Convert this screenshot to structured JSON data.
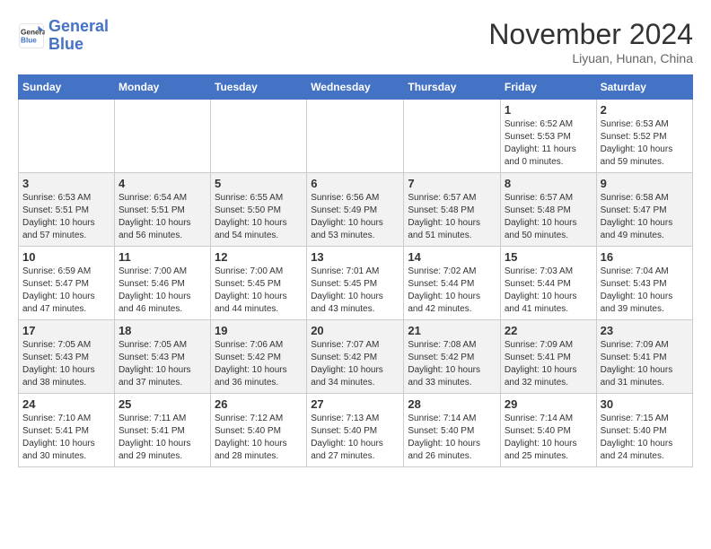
{
  "logo": {
    "line1": "General",
    "line2": "Blue"
  },
  "header": {
    "title": "November 2024",
    "subtitle": "Liyuan, Hunan, China"
  },
  "weekdays": [
    "Sunday",
    "Monday",
    "Tuesday",
    "Wednesday",
    "Thursday",
    "Friday",
    "Saturday"
  ],
  "weeks": [
    [
      {
        "day": "",
        "info": ""
      },
      {
        "day": "",
        "info": ""
      },
      {
        "day": "",
        "info": ""
      },
      {
        "day": "",
        "info": ""
      },
      {
        "day": "",
        "info": ""
      },
      {
        "day": "1",
        "info": "Sunrise: 6:52 AM\nSunset: 5:53 PM\nDaylight: 11 hours and 0 minutes."
      },
      {
        "day": "2",
        "info": "Sunrise: 6:53 AM\nSunset: 5:52 PM\nDaylight: 10 hours and 59 minutes."
      }
    ],
    [
      {
        "day": "3",
        "info": "Sunrise: 6:53 AM\nSunset: 5:51 PM\nDaylight: 10 hours and 57 minutes."
      },
      {
        "day": "4",
        "info": "Sunrise: 6:54 AM\nSunset: 5:51 PM\nDaylight: 10 hours and 56 minutes."
      },
      {
        "day": "5",
        "info": "Sunrise: 6:55 AM\nSunset: 5:50 PM\nDaylight: 10 hours and 54 minutes."
      },
      {
        "day": "6",
        "info": "Sunrise: 6:56 AM\nSunset: 5:49 PM\nDaylight: 10 hours and 53 minutes."
      },
      {
        "day": "7",
        "info": "Sunrise: 6:57 AM\nSunset: 5:48 PM\nDaylight: 10 hours and 51 minutes."
      },
      {
        "day": "8",
        "info": "Sunrise: 6:57 AM\nSunset: 5:48 PM\nDaylight: 10 hours and 50 minutes."
      },
      {
        "day": "9",
        "info": "Sunrise: 6:58 AM\nSunset: 5:47 PM\nDaylight: 10 hours and 49 minutes."
      }
    ],
    [
      {
        "day": "10",
        "info": "Sunrise: 6:59 AM\nSunset: 5:47 PM\nDaylight: 10 hours and 47 minutes."
      },
      {
        "day": "11",
        "info": "Sunrise: 7:00 AM\nSunset: 5:46 PM\nDaylight: 10 hours and 46 minutes."
      },
      {
        "day": "12",
        "info": "Sunrise: 7:00 AM\nSunset: 5:45 PM\nDaylight: 10 hours and 44 minutes."
      },
      {
        "day": "13",
        "info": "Sunrise: 7:01 AM\nSunset: 5:45 PM\nDaylight: 10 hours and 43 minutes."
      },
      {
        "day": "14",
        "info": "Sunrise: 7:02 AM\nSunset: 5:44 PM\nDaylight: 10 hours and 42 minutes."
      },
      {
        "day": "15",
        "info": "Sunrise: 7:03 AM\nSunset: 5:44 PM\nDaylight: 10 hours and 41 minutes."
      },
      {
        "day": "16",
        "info": "Sunrise: 7:04 AM\nSunset: 5:43 PM\nDaylight: 10 hours and 39 minutes."
      }
    ],
    [
      {
        "day": "17",
        "info": "Sunrise: 7:05 AM\nSunset: 5:43 PM\nDaylight: 10 hours and 38 minutes."
      },
      {
        "day": "18",
        "info": "Sunrise: 7:05 AM\nSunset: 5:43 PM\nDaylight: 10 hours and 37 minutes."
      },
      {
        "day": "19",
        "info": "Sunrise: 7:06 AM\nSunset: 5:42 PM\nDaylight: 10 hours and 36 minutes."
      },
      {
        "day": "20",
        "info": "Sunrise: 7:07 AM\nSunset: 5:42 PM\nDaylight: 10 hours and 34 minutes."
      },
      {
        "day": "21",
        "info": "Sunrise: 7:08 AM\nSunset: 5:42 PM\nDaylight: 10 hours and 33 minutes."
      },
      {
        "day": "22",
        "info": "Sunrise: 7:09 AM\nSunset: 5:41 PM\nDaylight: 10 hours and 32 minutes."
      },
      {
        "day": "23",
        "info": "Sunrise: 7:09 AM\nSunset: 5:41 PM\nDaylight: 10 hours and 31 minutes."
      }
    ],
    [
      {
        "day": "24",
        "info": "Sunrise: 7:10 AM\nSunset: 5:41 PM\nDaylight: 10 hours and 30 minutes."
      },
      {
        "day": "25",
        "info": "Sunrise: 7:11 AM\nSunset: 5:41 PM\nDaylight: 10 hours and 29 minutes."
      },
      {
        "day": "26",
        "info": "Sunrise: 7:12 AM\nSunset: 5:40 PM\nDaylight: 10 hours and 28 minutes."
      },
      {
        "day": "27",
        "info": "Sunrise: 7:13 AM\nSunset: 5:40 PM\nDaylight: 10 hours and 27 minutes."
      },
      {
        "day": "28",
        "info": "Sunrise: 7:14 AM\nSunset: 5:40 PM\nDaylight: 10 hours and 26 minutes."
      },
      {
        "day": "29",
        "info": "Sunrise: 7:14 AM\nSunset: 5:40 PM\nDaylight: 10 hours and 25 minutes."
      },
      {
        "day": "30",
        "info": "Sunrise: 7:15 AM\nSunset: 5:40 PM\nDaylight: 10 hours and 24 minutes."
      }
    ]
  ]
}
